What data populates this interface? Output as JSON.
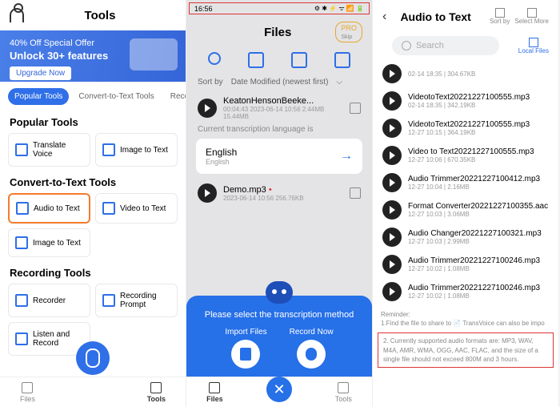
{
  "s1": {
    "title": "Tools",
    "banner": {
      "l1": "40% Off Special Offer",
      "l2": "Unlock 30+ features",
      "cta": "Upgrade Now"
    },
    "tabs": [
      "Popular Tools",
      "Convert-to-Text Tools",
      "Recording"
    ],
    "sections": [
      {
        "h": "Popular Tools",
        "items": [
          "Translate Voice",
          "Image to Text"
        ]
      },
      {
        "h": "Convert-to-Text Tools",
        "items": [
          "Audio to Text",
          "Video to Text",
          "Image to Text"
        ]
      },
      {
        "h": "Recording Tools",
        "items": [
          "Recorder",
          "Recording Prompt",
          "Listen and Record"
        ]
      }
    ],
    "nav": {
      "files": "Files",
      "tools": "Tools"
    }
  },
  "s2": {
    "time": "16:56",
    "title": "Files",
    "pro": "PRO",
    "skip": "Skip",
    "sort_l": "Sort by",
    "sort_v": "Date Modified (newest first)",
    "files": [
      {
        "n": "KeatonHensonBeeke...",
        "m": "00:04:43  2023-06-14 10:56  2.44MB  15.44MB"
      },
      {
        "n": "Demo.mp3",
        "dot": "•",
        "m": "2023-06-14 10:56  256.76KB"
      }
    ],
    "lang_label": "Current transcription language is",
    "lang": "English",
    "lang_sub": "English",
    "overlay": {
      "t": "Please select the transcription method",
      "b1": "Import Files",
      "b2": "Record Now"
    },
    "nav": {
      "files": "Files",
      "tools": "Tools"
    }
  },
  "s3": {
    "title": "Audio to Text",
    "hdr": {
      "sort": "Sort by",
      "select": "Select More",
      "local": "Local Files"
    },
    "search": "Search",
    "files": [
      {
        "n": "",
        "m": "02-14 18:35 | 304.67KB"
      },
      {
        "n": "VideotoText20221227100555.mp3",
        "m": "02-14 18:35 | 342.19KB"
      },
      {
        "n": "VideotoText20221227100555.mp3",
        "m": "12-27 10:15 | 364.19KB"
      },
      {
        "n": "Video to Text20221227100555.mp3",
        "m": "12-27 10:06 | 670.35KB"
      },
      {
        "n": "Audio Trimmer20221227100412.mp3",
        "m": "12-27 10:04 | 2.16MB"
      },
      {
        "n": "Format Converter20221227100355.aac",
        "m": "12-27 10:03 | 3.06MB"
      },
      {
        "n": "Audio Changer20221227100321.mp3",
        "m": "12-27 10:03 | 2.99MB"
      },
      {
        "n": "Audio Trimmer20221227100246.mp3",
        "m": "12-27 10:02 | 1.08MB"
      },
      {
        "n": "Audio Trimmer20221227100246.mp3",
        "m": "12-27 10:02 | 1.08MB"
      }
    ],
    "reminder": {
      "h": "Reminder:",
      "l1": "1.Find the file to share to  📄 TransVoice can also be impo",
      "l2": "2. Currently supported audio formats are: MP3, WAV, M4A, AMR, WMA, OGG, AAC, FLAC, and the size of a single file should not exceed 800M and 3 hours."
    }
  }
}
